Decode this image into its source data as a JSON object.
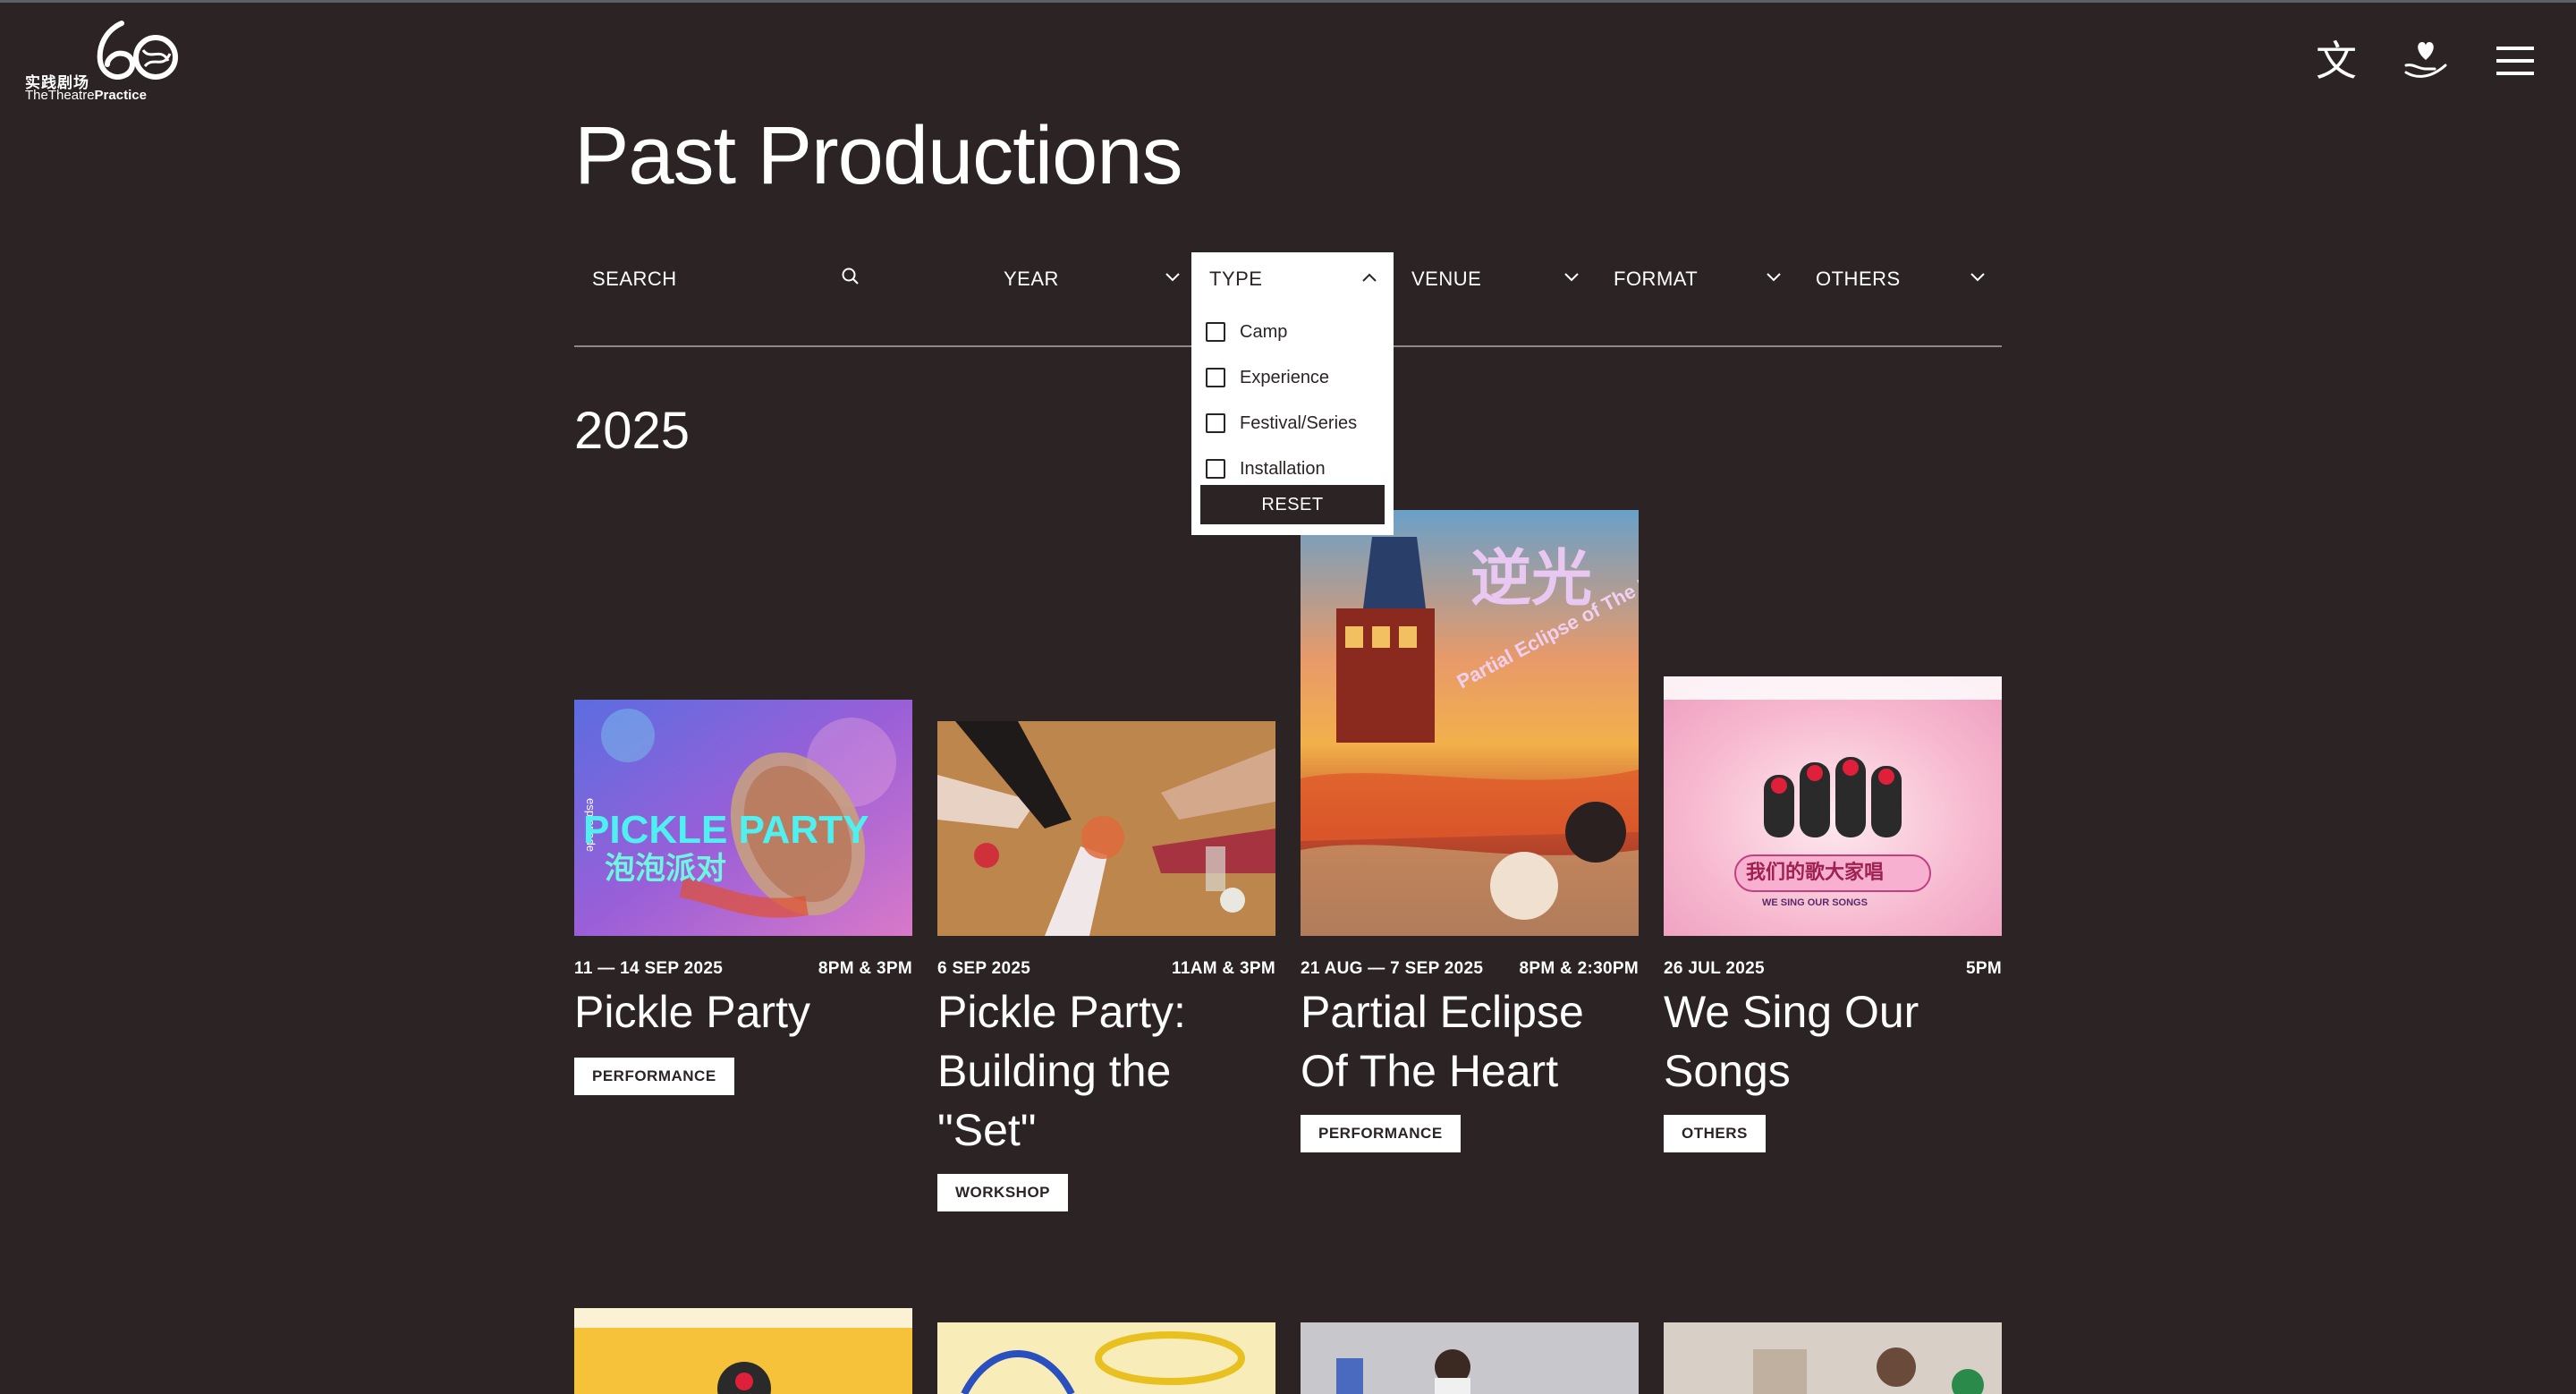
{
  "logo": {
    "cn": "实践剧场",
    "en_light": "TheTheatre",
    "en_bold": "Practice"
  },
  "header_icons": {
    "language": "文",
    "donate": "heart-hand-icon",
    "menu": "hamburger-icon"
  },
  "page_title": "Past Productions",
  "filters": {
    "search": "SEARCH",
    "year": "YEAR",
    "type": "TYPE",
    "venue": "VENUE",
    "format": "FORMAT",
    "others": "OTHERS"
  },
  "type_dropdown": {
    "options": [
      "Camp",
      "Experience",
      "Festival/Series",
      "Installation"
    ],
    "reset": "RESET"
  },
  "year_heading": "2025",
  "cards": [
    {
      "date": "11 — 14 SEP 2025",
      "time": "8PM & 3PM",
      "title": "Pickle Party",
      "tag": "PERFORMANCE"
    },
    {
      "date": "6 SEP 2025",
      "time": "11AM & 3PM",
      "title": "Pickle Party: Building the \"Set\"",
      "tag": "WORKSHOP"
    },
    {
      "date": "21 AUG — 7 SEP 2025",
      "time": "8PM & 2:30PM",
      "title": "Partial Eclipse Of The Heart",
      "tag": "PERFORMANCE"
    },
    {
      "date": "26 JUL 2025",
      "time": "5PM",
      "title": "We Sing Our Songs",
      "tag": "OTHERS"
    }
  ],
  "poster_text": {
    "pickle": "PICKLE PARTY",
    "pickle_cn": "泡泡派对",
    "esplanade": "esplanade",
    "eclipse_cn": "逆光",
    "eclipse": "Partial Eclipse of The Heart",
    "song_cn": "我们的歌大家唱",
    "song_en": "WE SING OUR SONGS"
  },
  "colors": {
    "background": "#2c2424",
    "text": "#ffffff",
    "tag_bg": "#ffffff",
    "tag_text": "#2c2424"
  }
}
